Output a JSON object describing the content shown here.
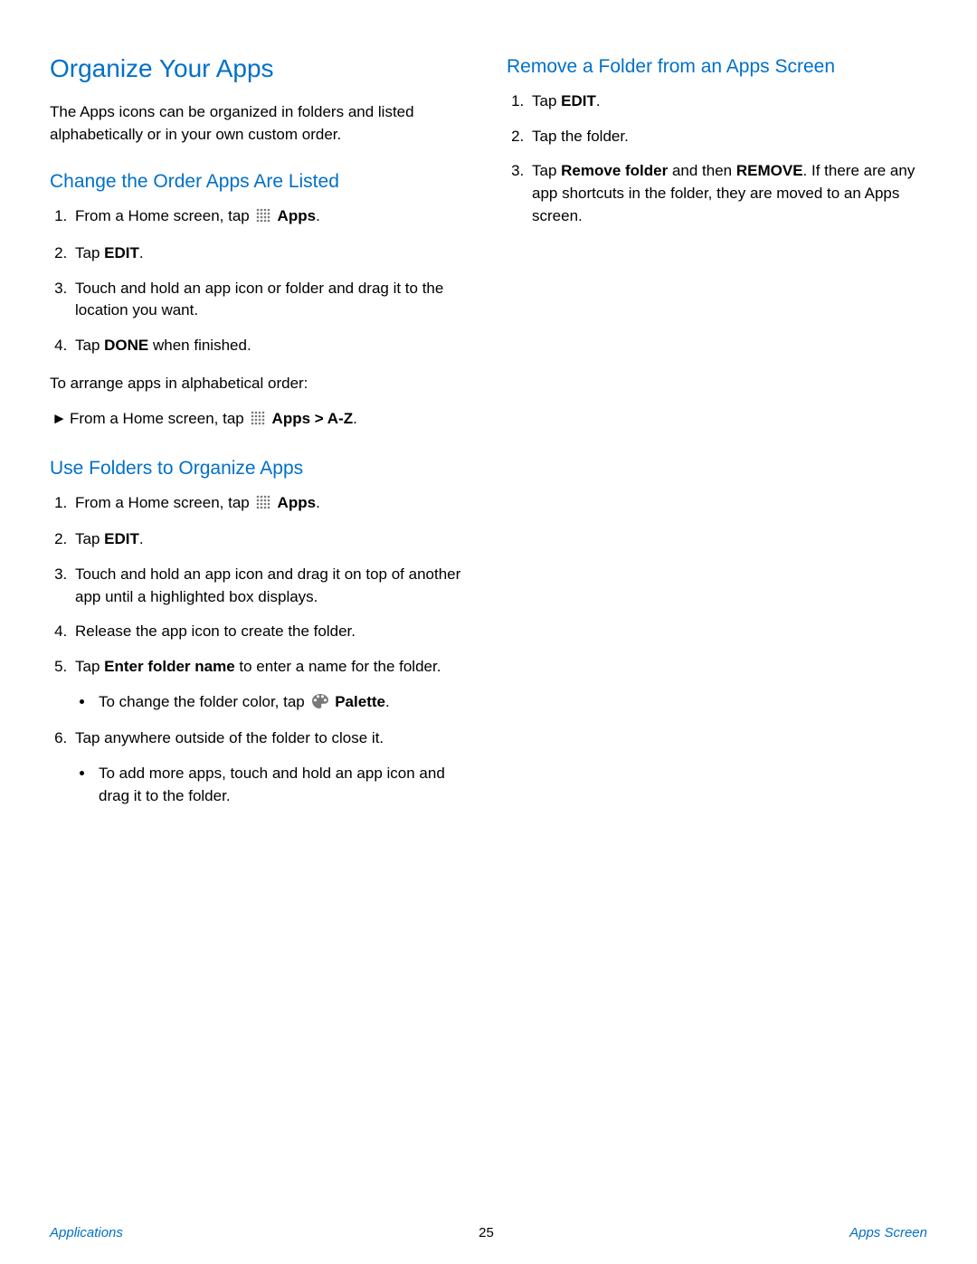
{
  "title": "Organize Your Apps",
  "intro": "The Apps icons can be organized in folders and listed alphabetically or in your own custom order.",
  "sec1": {
    "heading": "Change the Order Apps Are Listed",
    "s1a": "From a Home screen, tap ",
    "s1b": " Apps",
    "s1c": ".",
    "s2a": "Tap ",
    "s2b": "EDIT",
    "s2c": ".",
    "s3": "Touch and hold an app icon or folder and drag it to the location you want.",
    "s4a": "Tap ",
    "s4b": "DONE",
    "s4c": " when finished.",
    "alpha_intro": "To arrange apps in alphabetical order:",
    "arrow_a": "From a Home screen, tap ",
    "arrow_b": " Apps > A-Z",
    "arrow_c": "."
  },
  "sec2": {
    "heading": "Use Folders to Organize Apps",
    "s1a": "From a Home screen, tap ",
    "s1b": " Apps",
    "s1c": ".",
    "s2a": "Tap ",
    "s2b": "EDIT",
    "s2c": ".",
    "s3": "Touch and hold an app icon and drag it on top of another app until a highlighted box displays.",
    "s4": "Release the app icon to create the folder.",
    "s5a": "Tap ",
    "s5b": "Enter folder name",
    "s5c": " to enter a name for the folder.",
    "s5_sub_a": "To change the folder color, tap ",
    "s5_sub_b": " Palette",
    "s5_sub_c": ".",
    "s6": "Tap anywhere outside of the folder to close it.",
    "s6_sub": "To add more apps, touch and hold an app icon and drag it to the folder."
  },
  "sec3": {
    "heading": "Remove a Folder from an Apps Screen",
    "s1a": "Tap ",
    "s1b": "EDIT",
    "s1c": ".",
    "s2": "Tap the folder.",
    "s3a": "Tap ",
    "s3b": "Remove folder",
    "s3c": " and then ",
    "s3d": "REMOVE",
    "s3e": ". If there are any app shortcuts in the folder, they are moved to an Apps screen."
  },
  "footer": {
    "left": "Applications",
    "page": "25",
    "right": "Apps Screen"
  },
  "glyph": {
    "arrow": "►"
  }
}
